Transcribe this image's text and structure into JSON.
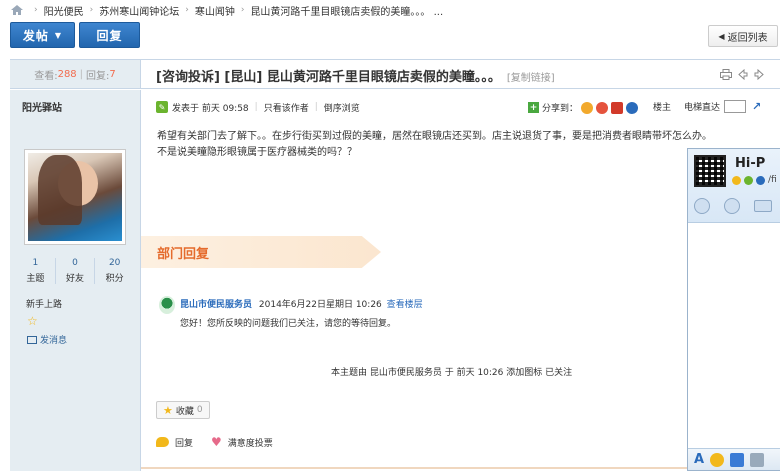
{
  "breadcrumb": {
    "items": [
      "阳光便民",
      "苏州寒山闻钟论坛",
      "寒山闻钟",
      "昆山黄河路千里目眼镜店卖假的美瞳。。。 ..."
    ],
    "separator": "›"
  },
  "toolbar": {
    "post_label": "发帖",
    "reply_label": "回复",
    "back_label": "返回列表"
  },
  "thread": {
    "views_label": "查看:",
    "views": "288",
    "replies_label": "回复:",
    "replies": "7",
    "title": "[咨询投诉] [昆山] 昆山黄河路千里目眼镜店卖假的美瞳。。。",
    "copy_link": "[复制链接]"
  },
  "user": {
    "name": "阳光驿站",
    "stats": [
      {
        "value": "1",
        "label": "主题"
      },
      {
        "value": "0",
        "label": "好友"
      },
      {
        "value": "20",
        "label": "积分"
      }
    ],
    "rank": "新手上路",
    "send_message": "发消息"
  },
  "post": {
    "posted_at": "发表于 前天 09:58",
    "only_author": "只看该作者",
    "reverse": "倒序浏览",
    "share_label": "分享到：",
    "floor_label": "楼主",
    "elevator_label": "电梯直达",
    "body_lines": [
      "希望有关部门去了解下。。在步行街买到过假的美瞳，居然在眼镜店还买到。店主说退货了事，要是把消费者眼睛带坏怎么办。",
      "不是说美瞳隐形眼镜属于医疗器械类的吗？？"
    ]
  },
  "dept_reply": {
    "heading": "部门回复",
    "org": "昆山市便民服务员",
    "date": "2014年6月22日星期日 10:26",
    "view_floor": "查看楼层",
    "text": "您好！您所反映的问题我们已关注，请您的等待回复。"
  },
  "topic_note": "本主题由 昆山市便民服务员 于 前天 10:26 添加图标 已关注",
  "favorite": {
    "label": "收藏",
    "count": "0"
  },
  "actions": {
    "reply": "回复",
    "vote": "满意度投票"
  },
  "chat": {
    "title": "Hi-P",
    "sub": "/fi"
  },
  "colors": {
    "accent_blue": "#2266ae",
    "count_orange": "#f26c4f",
    "dept_orange": "#e56b2c",
    "link_blue": "#2a6bbb"
  }
}
